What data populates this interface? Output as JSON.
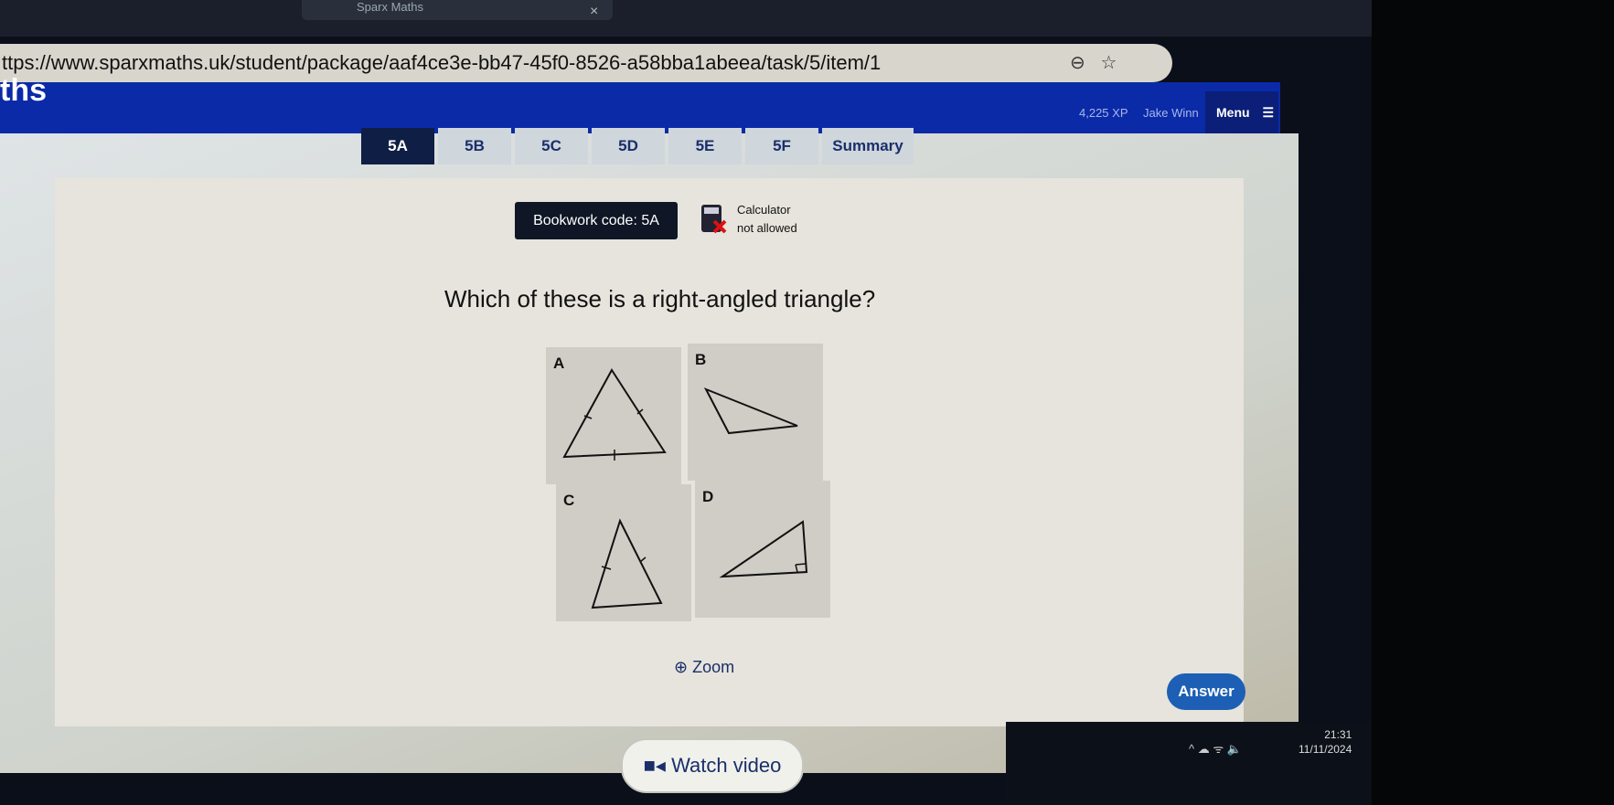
{
  "browser": {
    "tab_title": "Sparx Maths",
    "url": "ttps://www.sparxmaths.uk/student/package/aaf4ce3e-bb47-45f0-8526-a58bba1abeea/task/5/item/1"
  },
  "header": {
    "logo": "ths",
    "xp": "4,225 XP",
    "user": "Jake Winn",
    "menu": "Menu"
  },
  "tabs": [
    "5A",
    "5B",
    "5C",
    "5D",
    "5E",
    "5F",
    "Summary"
  ],
  "active_tab": "5A",
  "question": {
    "bookwork": "Bookwork code: 5A",
    "calculator_line1": "Calculator",
    "calculator_line2": "not allowed",
    "text": "Which of these is a right-angled triangle?",
    "options": [
      {
        "label": "A"
      },
      {
        "label": "B"
      },
      {
        "label": "C"
      },
      {
        "label": "D"
      }
    ]
  },
  "actions": {
    "zoom": "Zoom",
    "answer": "Answer",
    "watch_video": "Watch video"
  },
  "taskbar": {
    "time": "21:31",
    "date": "11/11/2024"
  },
  "colors": {
    "header": "#0a2aa8",
    "answer": "#1c5fb5",
    "active_tab": "#0f1e44"
  }
}
